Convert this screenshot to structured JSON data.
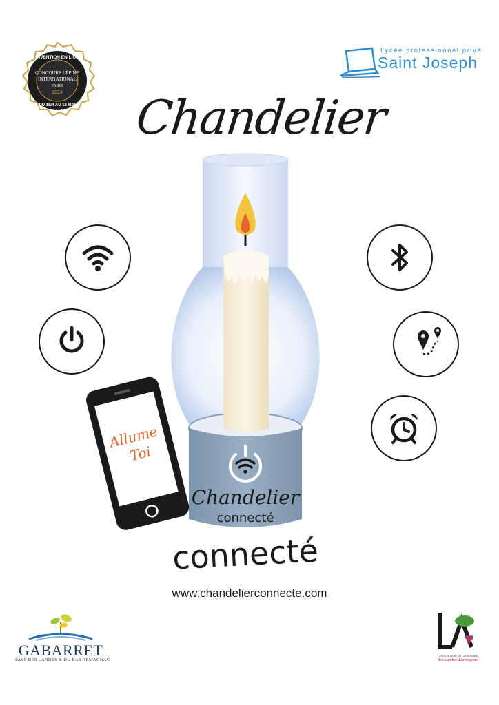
{
  "badge": {
    "top_text": "INVENTION EN LICE",
    "line1": "CONCOURS LÉPINE",
    "line2": "INTERNATIONAL",
    "line3": "PARIS",
    "year": "2024",
    "bottom_text": "DU 1ER AU 12 MAI"
  },
  "school": {
    "subtitle": "Lycée professionnel privé",
    "name": "Saint Joseph"
  },
  "title": "Chandelier",
  "phone": {
    "screen_line1": "Allume",
    "screen_line2": "Toi"
  },
  "base": {
    "line1": "Chandelier",
    "line2": "connecté"
  },
  "subtitle": "connecté",
  "website": "www.chandelierconnecte.com",
  "footer_left": {
    "name": "GABARRET",
    "tagline": "PAYS DES LANDES & DU BAS ARMAGNAC"
  },
  "footer_right": {
    "line1": "Communauté de communes",
    "line2": "des Landes d'Armagnac"
  },
  "icons": {
    "left": [
      "wifi-icon",
      "power-icon"
    ],
    "right": [
      "bluetooth-icon",
      "route-icon",
      "alarm-clock-icon"
    ]
  },
  "colors": {
    "accent_orange": "#e8622a",
    "school_blue": "#2a8fd0",
    "base_blue": "#8aa0b8",
    "gold": "#c9a24a"
  }
}
